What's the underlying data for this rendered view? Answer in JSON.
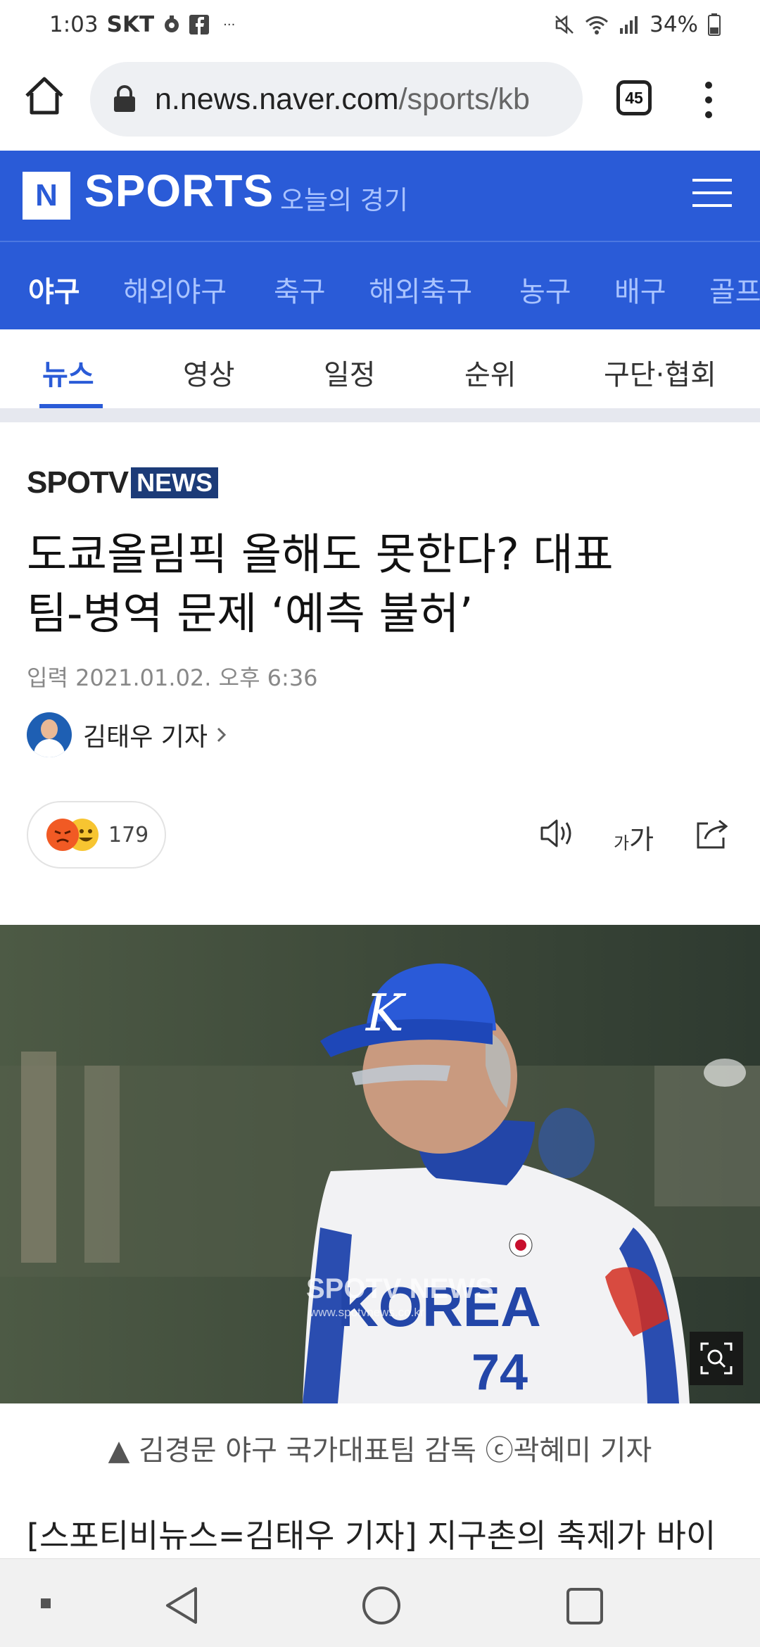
{
  "status_bar": {
    "time": "1:03",
    "carrier": "SKT",
    "more": "···",
    "battery": "34%"
  },
  "browser": {
    "url_host": "n.news.naver.com",
    "url_path": "/sports/kb",
    "tab_count": "45"
  },
  "naver_header": {
    "logo_letter": "N",
    "brand": "SPORTS",
    "today_games": "오늘의 경기"
  },
  "sport_tabs": [
    {
      "label": "야구",
      "active": true
    },
    {
      "label": "해외야구"
    },
    {
      "label": "축구"
    },
    {
      "label": "해외축구"
    },
    {
      "label": "농구"
    },
    {
      "label": "배구"
    },
    {
      "label": "골프"
    }
  ],
  "sub_tabs": [
    {
      "label": "뉴스",
      "active": true
    },
    {
      "label": "영상"
    },
    {
      "label": "일정"
    },
    {
      "label": "순위"
    },
    {
      "label": "구단·협회"
    }
  ],
  "article": {
    "press_name_a": "SPOTV",
    "press_name_b": "NEWS",
    "headline_line1": "도쿄올림픽 올해도 못한다? 대표",
    "headline_line2": "팀-병역 문제 ‘예측 불허’",
    "date_label": "입력",
    "date": "2021.01.02. 오후 6:36",
    "author": "김태우 기자",
    "reaction_count": "179",
    "font_size_small": "가",
    "font_size_large": "가",
    "photo_watermark": "SPOTV NEWS",
    "photo_watermark_url": "www.spotvnews.co.kr",
    "jersey_number": "74",
    "jersey_text": "KOREA",
    "caption": "▲ 김경문 야구 국가대표팀 감독 ⓒ곽혜미 기자",
    "body_first_line": "[스포티비뉴스=김태우 기자] 지구촌의 축제가 바이"
  }
}
